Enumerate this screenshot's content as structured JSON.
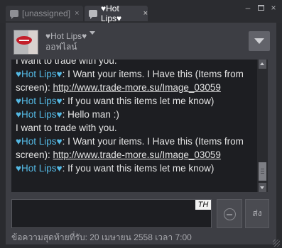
{
  "tabs": [
    {
      "label": "[unassigned]",
      "active": false,
      "close": "×"
    },
    {
      "label": "♥Hot Lips♥",
      "active": true,
      "close": "×"
    }
  ],
  "window_controls": {
    "minimize": "–",
    "close": "×"
  },
  "contact": {
    "name": "♥Hot Lips♥",
    "status": "ออฟไลน์"
  },
  "messages": [
    {
      "type": "text",
      "text": "I want to trade with you."
    },
    {
      "type": "msg",
      "sender": "♥Hot Lips♥",
      "sep": ": ",
      "text": "I Want your items. I Have this (Items from screen): ",
      "link": "http://www.trade-more.su/Image_03059"
    },
    {
      "type": "msg",
      "sender": "♥Hot Lips♥",
      "sep": ": ",
      "text": "If you want this items let me know)"
    },
    {
      "type": "msg",
      "sender": "♥Hot Lips♥",
      "sep": ": ",
      "text": "Hello man :)"
    },
    {
      "type": "text",
      "text": "I want to trade with you."
    },
    {
      "type": "msg",
      "sender": "♥Hot Lips♥",
      "sep": ": ",
      "text": "I Want your items. I Have this (Items from screen): ",
      "link": "http://www.trade-more.su/Image_03059"
    },
    {
      "type": "msg",
      "sender": "♥Hot Lips♥",
      "sep": ": ",
      "text": "If you want this items let me know)"
    }
  ],
  "input": {
    "value": "",
    "language_badge": "TH"
  },
  "send_label": "ส่ง",
  "footer": "ข้อความสุดท้ายที่รับ: 20 เมษายน 2558 เวลา 7:00",
  "colors": {
    "sender_name": "#54b9e4",
    "log_background": "#1d1e22",
    "panel_background": "#3d3e44"
  }
}
